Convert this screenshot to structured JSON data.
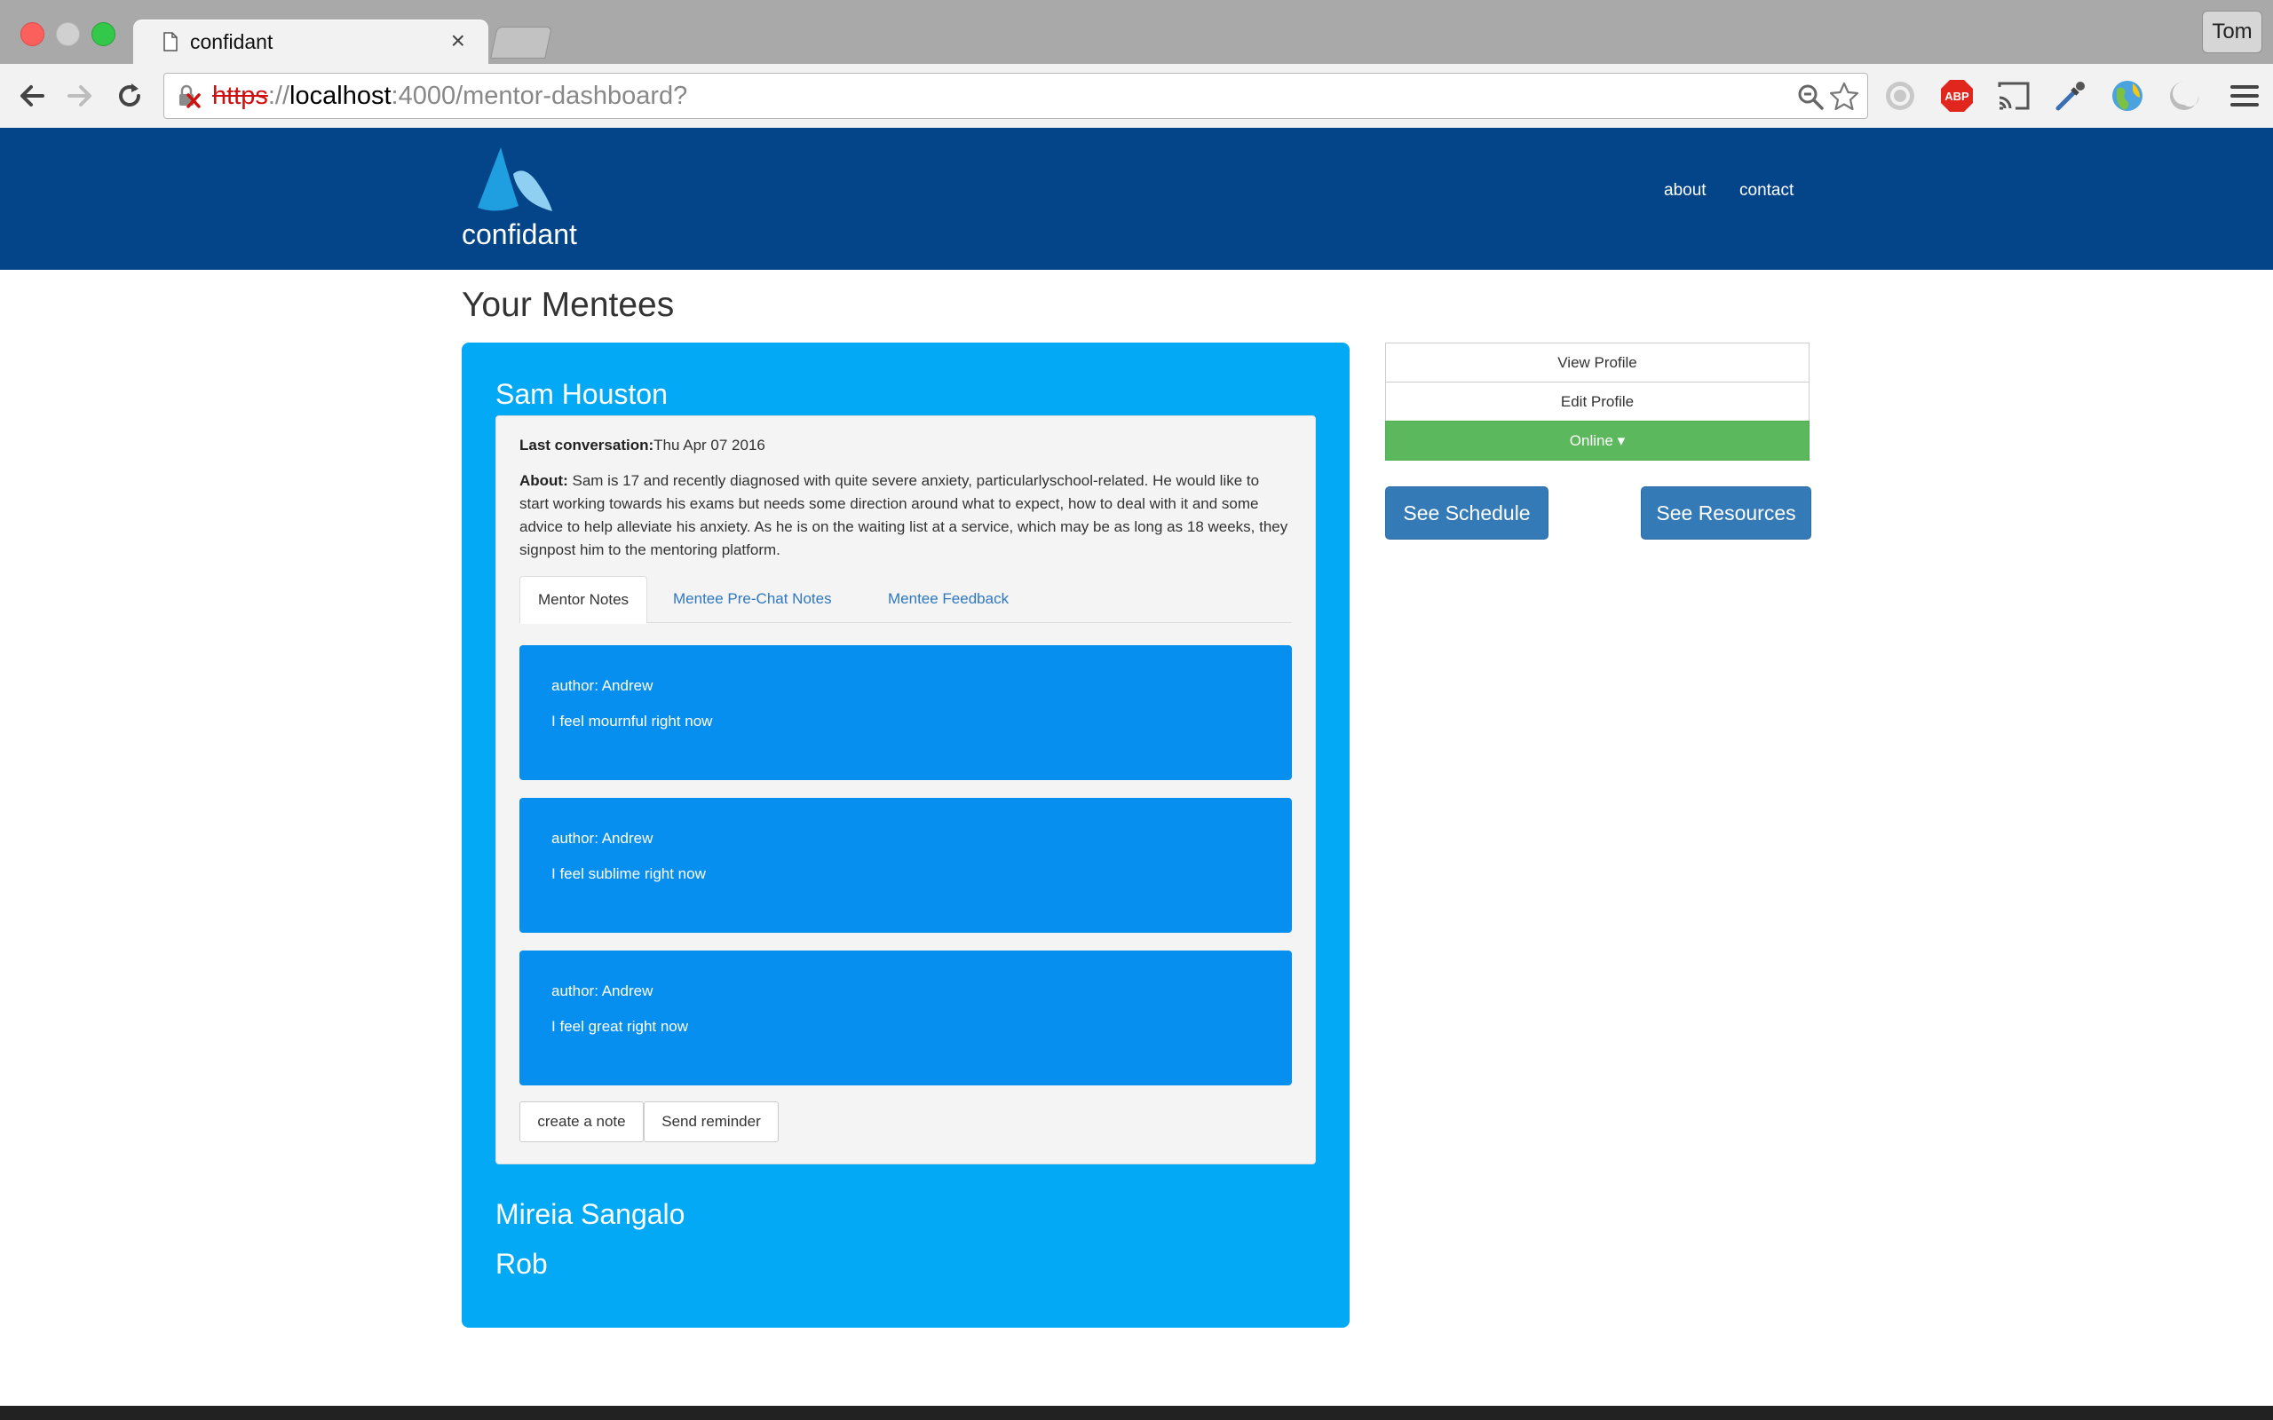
{
  "browser": {
    "tab_title": "confidant",
    "profile_name": "Tom",
    "url": {
      "scheme": "https",
      "separator": "://",
      "host": "localhost",
      "path": ":4000/mentor-dashboard?"
    },
    "extension_icons": [
      "search-icon",
      "star-icon",
      "circle-a-icon",
      "adblock-icon",
      "cast-icon",
      "eyedropper-icon",
      "globe-icon",
      "swirl-icon",
      "menu-icon"
    ]
  },
  "header": {
    "logo_text": "confidant",
    "nav": {
      "about": "about",
      "contact": "contact"
    },
    "colors": {
      "bar": "#04458a",
      "logo_dark": "#1f9ee0",
      "logo_light": "#8ecff2"
    }
  },
  "main": {
    "title": "Your Mentees",
    "mentees": [
      {
        "name": "Sam Houston",
        "last_conversation_label": "Last conversation:",
        "last_conversation_value": "Thu Apr 07 2016",
        "about_label": "About:",
        "about_text": "Sam is 17 and recently diagnosed with quite severe anxiety, particularlyschool-related. He would like to start working towards his exams but needs some direction around what to expect, how to deal with it and some advice to help alleviate his anxiety. As he is on the waiting list at a service, which may be as long as 18 weeks, they signpost him to the mentoring platform.",
        "tabs": [
          "Mentor Notes",
          "Mentee Pre-Chat Notes",
          "Mentee Feedback"
        ],
        "notes": [
          {
            "author": "author: Andrew",
            "text": "I feel mournful right now"
          },
          {
            "author": "author: Andrew",
            "text": "I feel sublime right now"
          },
          {
            "author": "author: Andrew",
            "text": "I feel great right now"
          }
        ],
        "buttons": {
          "create": "create a note",
          "reminder": "Send reminder"
        }
      },
      {
        "name": "Mireia Sangalo"
      },
      {
        "name": "Rob"
      }
    ]
  },
  "sidebar": {
    "view_profile": "View Profile",
    "edit_profile": "Edit Profile",
    "status": "Online ▾",
    "see_schedule": "See Schedule",
    "see_resources": "See Resources",
    "colors": {
      "online": "#5cb85c",
      "primary": "#337ab7"
    }
  }
}
